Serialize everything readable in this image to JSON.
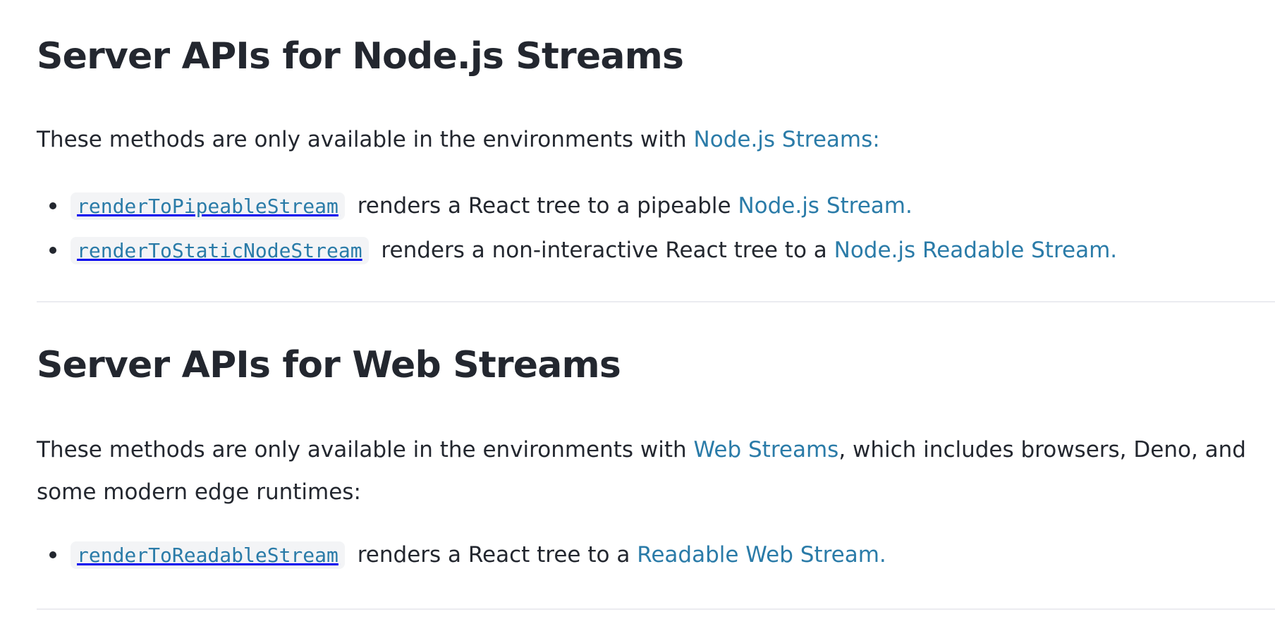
{
  "sections": {
    "node": {
      "heading": "Server APIs for Node.js Streams",
      "intro_text": "These methods are only available in the environments with ",
      "intro_link": "Node.js Streams:",
      "items": [
        {
          "code": "renderToPipeableStream",
          "text": " renders a React tree to a pipeable ",
          "link": "Node.js Stream."
        },
        {
          "code": "renderToStaticNodeStream",
          "text": " renders a non-interactive React tree to a ",
          "link": "Node.js Readable Stream."
        }
      ]
    },
    "web": {
      "heading": "Server APIs for Web Streams",
      "intro_text": "These methods are only available in the environments with ",
      "intro_link": "Web Streams",
      "intro_tail": ", which includes browsers, Deno, and some modern edge runtimes:",
      "items": [
        {
          "code": "renderToReadableStream",
          "text": " renders a React tree to a ",
          "link": "Readable Web Stream."
        }
      ]
    }
  },
  "colors": {
    "text": "#23272f",
    "link": "#2a7ba8",
    "code_bg": "#f3f4f6",
    "divider": "#ebecf0"
  }
}
